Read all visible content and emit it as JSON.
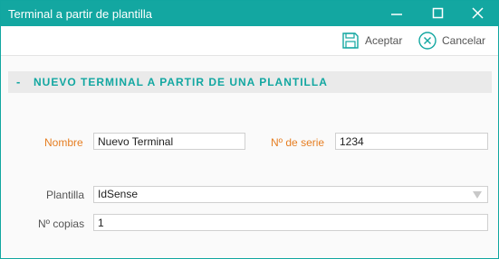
{
  "window": {
    "title": "Terminal a partir de plantilla"
  },
  "toolbar": {
    "accept_label": "Aceptar",
    "cancel_label": "Cancelar"
  },
  "section": {
    "toggle": "-",
    "title": "NUEVO TERMINAL A PARTIR DE UNA PLANTILLA"
  },
  "form": {
    "name_label": "Nombre",
    "name_value": "Nuevo Terminal",
    "serial_label": "Nº de serie",
    "serial_value": "1234",
    "template_label": "Plantilla",
    "template_value": "IdSense",
    "copies_label": "Nº copias",
    "copies_value": "1"
  },
  "colors": {
    "accent": "#13a7a1",
    "required_label": "#e67e22"
  },
  "icons": {
    "minimize": "minimize-icon",
    "maximize": "maximize-icon",
    "close": "close-icon",
    "save": "save-icon",
    "cancel": "cancel-circle-icon",
    "dropdown": "chevron-down-icon"
  }
}
